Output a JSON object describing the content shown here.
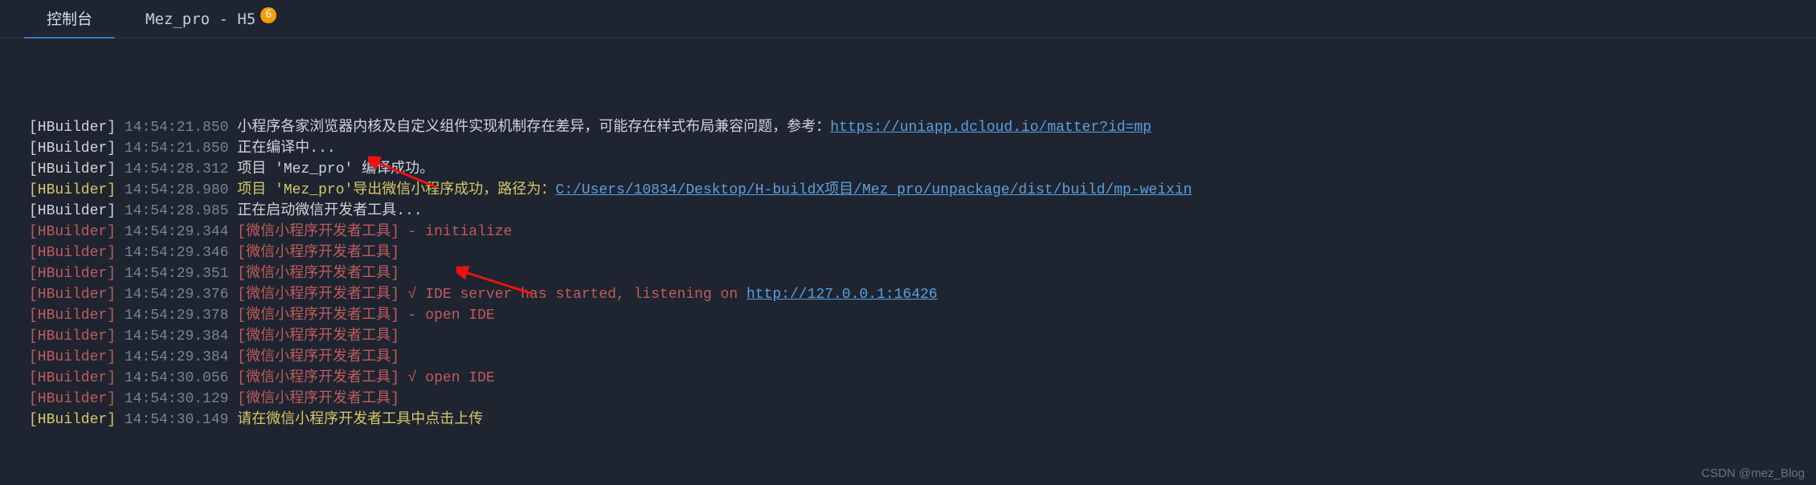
{
  "tabs": {
    "console": "控制台",
    "project": "Mez_pro - H5",
    "badge": "6"
  },
  "watermark": "CSDN @mez_Blog",
  "lines": [
    {
      "tag": "[HBuilder]",
      "tagc": "c-white",
      "time": "14:54:21.850",
      "msgc": "c-white",
      "msg": "小程序各家浏览器内核及自定义组件实现机制存在差异，可能存在样式布局兼容问题，参考：",
      "link": "https://uniapp.dcloud.io/matter?id=mp"
    },
    {
      "tag": "[HBuilder]",
      "tagc": "c-white",
      "time": "14:54:21.850",
      "msgc": "c-white",
      "msg": "正在编译中..."
    },
    {
      "tag": "[HBuilder]",
      "tagc": "c-white",
      "time": "14:54:28.312",
      "msgc": "c-white",
      "msg": "项目 'Mez_pro' 编译成功。"
    },
    {
      "tag": "[HBuilder]",
      "tagc": "c-yellow",
      "time": "14:54:28.980",
      "msgc": "c-yellow",
      "msg": "项目 'Mez_pro'导出微信小程序成功，路径为：",
      "link": "C:/Users/10834/Desktop/H-buildX项目/Mez_pro/unpackage/dist/build/mp-weixin"
    },
    {
      "tag": "[HBuilder]",
      "tagc": "c-white",
      "time": "14:54:28.985",
      "msgc": "c-white",
      "msg": "正在启动微信开发者工具..."
    },
    {
      "tag": "[HBuilder]",
      "tagc": "c-red",
      "time": "14:54:29.344",
      "msgc": "c-red",
      "msg": "[微信小程序开发者工具] - initialize"
    },
    {
      "tag": "[HBuilder]",
      "tagc": "c-red",
      "time": "14:54:29.346",
      "msgc": "c-red",
      "msg": "[微信小程序开发者工具]"
    },
    {
      "tag": "[HBuilder]",
      "tagc": "c-red",
      "time": "14:54:29.351",
      "msgc": "c-red",
      "msg": "[微信小程序开发者工具]"
    },
    {
      "tag": "[HBuilder]",
      "tagc": "c-red",
      "time": "14:54:29.376",
      "msgc": "c-red",
      "msg": "[微信小程序开发者工具] √ IDE server has started, listening on ",
      "link": "http://127.0.0.1:16426"
    },
    {
      "tag": "[HBuilder]",
      "tagc": "c-red",
      "time": "14:54:29.378",
      "msgc": "c-red",
      "msg": "[微信小程序开发者工具] - open IDE"
    },
    {
      "tag": "[HBuilder]",
      "tagc": "c-red",
      "time": "14:54:29.384",
      "msgc": "c-red",
      "msg": "[微信小程序开发者工具]"
    },
    {
      "tag": "[HBuilder]",
      "tagc": "c-red",
      "time": "14:54:29.384",
      "msgc": "c-red",
      "msg": "[微信小程序开发者工具]"
    },
    {
      "tag": "[HBuilder]",
      "tagc": "c-red",
      "time": "14:54:30.056",
      "msgc": "c-red",
      "msg": "[微信小程序开发者工具] √ open IDE"
    },
    {
      "tag": "[HBuilder]",
      "tagc": "c-red",
      "time": "14:54:30.129",
      "msgc": "c-red",
      "msg": "[微信小程序开发者工具]"
    },
    {
      "tag": "[HBuilder]",
      "tagc": "c-yellow",
      "time": "14:54:30.149",
      "msgc": "c-yellow",
      "msg": "请在微信小程序开发者工具中点击上传"
    }
  ]
}
